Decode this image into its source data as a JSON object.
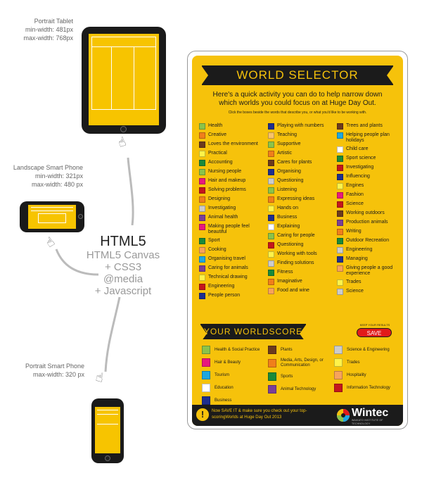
{
  "captions": {
    "tablet": [
      "Portrait Tablet",
      "min-width: 481px",
      "max-width: 768px"
    ],
    "landscape": [
      "Landscape Smart Phone",
      "min-width: 321px",
      "max-width: 480 px"
    ],
    "portrait": [
      "Portrait Smart Phone",
      "max-width: 320 px"
    ]
  },
  "tech": {
    "title": "HTML5",
    "lines": [
      "HTML5 Canvas",
      "+ CSS3 @media",
      "+ Javascript"
    ]
  },
  "poster": {
    "title": "WORLD SELECTOR",
    "intro": "Here's a quick activity you can do to help narrow down which worlds you could focus on at Huge Day Out.",
    "hint": "Click the boxes beside the words that describe you, or what you'd like to be working with.",
    "columns": [
      [
        {
          "label": "Health",
          "color": "#8bc34a"
        },
        {
          "label": "Creative",
          "color": "#f07f1b"
        },
        {
          "label": "Loves the environment",
          "color": "#6b3a1e"
        },
        {
          "label": "Practical",
          "color": "#fff34a"
        },
        {
          "label": "Accounting",
          "color": "#1a8a3a"
        },
        {
          "label": "Nursing people",
          "color": "#8bc34a"
        },
        {
          "label": "Hair and makeup",
          "color": "#e8197d"
        },
        {
          "label": "Solving problems",
          "color": "#c4161c"
        },
        {
          "label": "Designing",
          "color": "#f07f1b"
        },
        {
          "label": "Investigating",
          "color": "#cccccc"
        },
        {
          "label": "Animal health",
          "color": "#7a3f98"
        },
        {
          "label": "Making people feel beautiful",
          "color": "#e8197d"
        },
        {
          "label": "Sport",
          "color": "#1a8a3a"
        },
        {
          "label": "Cooking",
          "color": "#f7a35c"
        },
        {
          "label": "Organising travel",
          "color": "#1ea7e0"
        },
        {
          "label": "Caring for animals",
          "color": "#7a3f98"
        },
        {
          "label": "Technical drawing",
          "color": "#fff34a"
        },
        {
          "label": "Engineering",
          "color": "#c4161c"
        },
        {
          "label": "People person",
          "color": "#1e2f8f"
        }
      ],
      [
        {
          "label": "Playing with numbers",
          "color": "#1e2f8f"
        },
        {
          "label": "Teaching",
          "color": "#f7c36b"
        },
        {
          "label": "Supportive",
          "color": "#8bc34a"
        },
        {
          "label": "Artistic",
          "color": "#f07f1b"
        },
        {
          "label": "Cares for plants",
          "color": "#6b3a1e"
        },
        {
          "label": "Organising",
          "color": "#1e2f8f"
        },
        {
          "label": "Questioning",
          "color": "#cccccc"
        },
        {
          "label": "Listening",
          "color": "#8bc34a"
        },
        {
          "label": "Expressing ideas",
          "color": "#f07f1b"
        },
        {
          "label": "Hands on",
          "color": "#fff34a"
        },
        {
          "label": "Business",
          "color": "#1e2f8f"
        },
        {
          "label": "Explaining",
          "color": "#ffffff"
        },
        {
          "label": "Caring for people",
          "color": "#8bc34a"
        },
        {
          "label": "Questioning",
          "color": "#c4161c"
        },
        {
          "label": "Working with tools",
          "color": "#fff34a"
        },
        {
          "label": "Finding solutions",
          "color": "#cccccc"
        },
        {
          "label": "Fitness",
          "color": "#1a8a3a"
        },
        {
          "label": "Imaginative",
          "color": "#f07f1b"
        },
        {
          "label": "Food and wine",
          "color": "#f7a35c"
        }
      ],
      [
        {
          "label": "Trees and plants",
          "color": "#6b3a1e"
        },
        {
          "label": "Helping people plan holidays",
          "color": "#1ea7e0"
        },
        {
          "label": "Child care",
          "color": "#ffffff"
        },
        {
          "label": "Sport science",
          "color": "#1a8a3a"
        },
        {
          "label": "Investigating",
          "color": "#c4161c"
        },
        {
          "label": "Influencing",
          "color": "#1e2f8f"
        },
        {
          "label": "Engines",
          "color": "#fff34a"
        },
        {
          "label": "Fashion",
          "color": "#e8197d"
        },
        {
          "label": "Science",
          "color": "#c4161c"
        },
        {
          "label": "Working outdoors",
          "color": "#6b3a1e"
        },
        {
          "label": "Production animals",
          "color": "#7a3f98"
        },
        {
          "label": "Writing",
          "color": "#f07f1b"
        },
        {
          "label": "Outdoor Recreation",
          "color": "#1a8a3a"
        },
        {
          "label": "Engineering",
          "color": "#cccccc"
        },
        {
          "label": "Managing",
          "color": "#1e2f8f"
        },
        {
          "label": "Giving people a good experience",
          "color": "#f7a35c"
        },
        {
          "label": "Trades",
          "color": "#fff34a"
        },
        {
          "label": "Science",
          "color": "#cccccc"
        }
      ]
    ],
    "worldscore": {
      "title": "YOUR WORLDSCORE",
      "keep": "KEEP YOUR RESULTS",
      "save": "SAVE",
      "columns": [
        [
          {
            "label": "Health & Social Practice",
            "color": "#8bc34a"
          },
          {
            "label": "Hair & Beauty",
            "color": "#e8197d"
          },
          {
            "label": "Tourism",
            "color": "#1ea7e0"
          },
          {
            "label": "Education",
            "color": "#ffffff"
          },
          {
            "label": "Business",
            "color": "#1e2f8f"
          }
        ],
        [
          {
            "label": "Plants",
            "color": "#6b3a1e"
          },
          {
            "label": "Media, Arts, Design, or Communication",
            "color": "#f07f1b"
          },
          {
            "label": "Sports",
            "color": "#1a8a3a"
          },
          {
            "label": "Animal Technology",
            "color": "#7a3f98"
          }
        ],
        [
          {
            "label": "Science & Engineering",
            "color": "#cccccc"
          },
          {
            "label": "Trades",
            "color": "#fff34a"
          },
          {
            "label": "Hospitality",
            "color": "#f7a35c"
          },
          {
            "label": "Information Technology",
            "color": "#c4161c"
          }
        ]
      ]
    },
    "footer": {
      "bang": "!",
      "text": "Now SAVE IT & make sure you check out your top-scoringWorlds at Huge Day Out 2013",
      "logo": "Wintec",
      "logo_sub": "WAIKATO INSTITUTE OF TECHNOLOGY"
    }
  }
}
